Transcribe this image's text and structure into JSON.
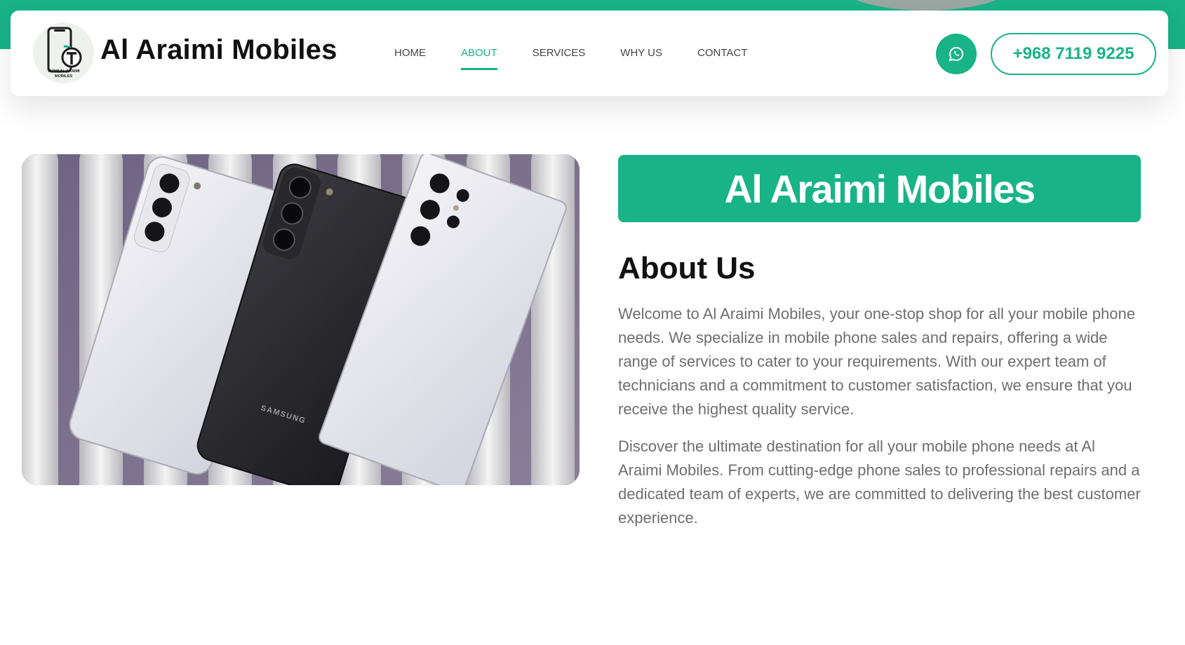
{
  "colors": {
    "accent": "#18b387",
    "heading": "#111111",
    "body_text": "#6e6e6e",
    "nav_text": "#444444"
  },
  "header": {
    "logo": {
      "icon": "phone-logo-icon",
      "text": "TARIQ AL ARAIMI MOBILES"
    },
    "brand_name": "Al Araimi Mobiles",
    "nav": [
      {
        "label": "HOME",
        "active": false
      },
      {
        "label": "ABOUT",
        "active": true
      },
      {
        "label": "SERVICES",
        "active": false
      },
      {
        "label": "WHY US",
        "active": false
      },
      {
        "label": "CONTACT",
        "active": false
      }
    ],
    "whatsapp_icon": "whatsapp-icon",
    "phone": "+968 7119 9225"
  },
  "main": {
    "image_text": "SAMSUNG",
    "title_banner": "Al Araimi Mobiles",
    "heading": "About Us",
    "paragraphs": [
      "Welcome to Al Araimi Mobiles, your one-stop shop for all your mobile phone needs. We specialize in mobile phone sales and repairs, offering a wide range of services to cater to your requirements. With our expert team of technicians and a commitment to customer satisfaction, we ensure that you receive the highest quality service.",
      "Discover the ultimate destination for all your mobile phone needs at Al Araimi Mobiles. From cutting-edge phone sales to professional repairs and a dedicated team of experts, we are committed to delivering the best customer experience."
    ]
  }
}
